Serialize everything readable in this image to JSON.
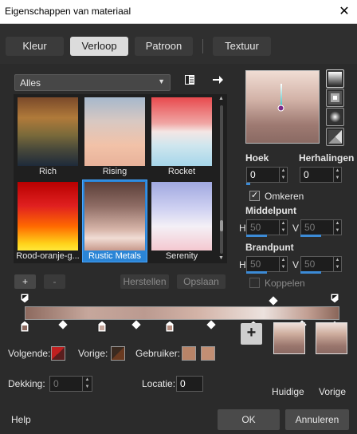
{
  "window": {
    "title": "Eigenschappen van materiaal",
    "close_glyph": "✕"
  },
  "tabs": [
    {
      "label": "Kleur",
      "active": false
    },
    {
      "label": "Verloop",
      "active": true
    },
    {
      "label": "Patroon",
      "active": false
    },
    {
      "label": "Textuur",
      "active": false
    }
  ],
  "category": {
    "selected": "Alles"
  },
  "gallery": {
    "items": [
      {
        "label": "Rich"
      },
      {
        "label": "Rising"
      },
      {
        "label": "Rocket"
      },
      {
        "label": "Rood-oranje-g..."
      },
      {
        "label": "Rustic Metals",
        "selected": true
      },
      {
        "label": "Serenity"
      }
    ]
  },
  "gallery_buttons": {
    "add": "+",
    "remove": "-",
    "reset": "Herstellen",
    "save": "Opslaan"
  },
  "angle": {
    "label": "Hoek",
    "value": "0"
  },
  "repeats": {
    "label": "Herhalingen",
    "value": "0"
  },
  "invert": {
    "label": "Omkeren",
    "checked": true
  },
  "center": {
    "label": "Middelpunt",
    "h_label": "H",
    "h_value": "50",
    "v_label": "V",
    "v_value": "50"
  },
  "focal": {
    "label": "Brandpunt",
    "h_label": "H",
    "h_value": "50",
    "v_label": "V",
    "v_value": "50"
  },
  "link": {
    "label": "Koppelen",
    "checked": false
  },
  "swatches": {
    "next_label": "Volgende:",
    "prev_label": "Vorige:",
    "user_label": "Gebruiker:",
    "opacity_label": "Dekking:",
    "opacity_value": "0",
    "location_label": "Locatie:",
    "location_value": "0",
    "user_color_1": "#b88468",
    "user_color_2": "#c28f74"
  },
  "thumbs": {
    "current": "Huidige",
    "previous": "Vorige"
  },
  "footer": {
    "help": "Help",
    "ok": "OK",
    "cancel": "Annuleren"
  },
  "colors": {
    "accent": "#2b85d6"
  }
}
